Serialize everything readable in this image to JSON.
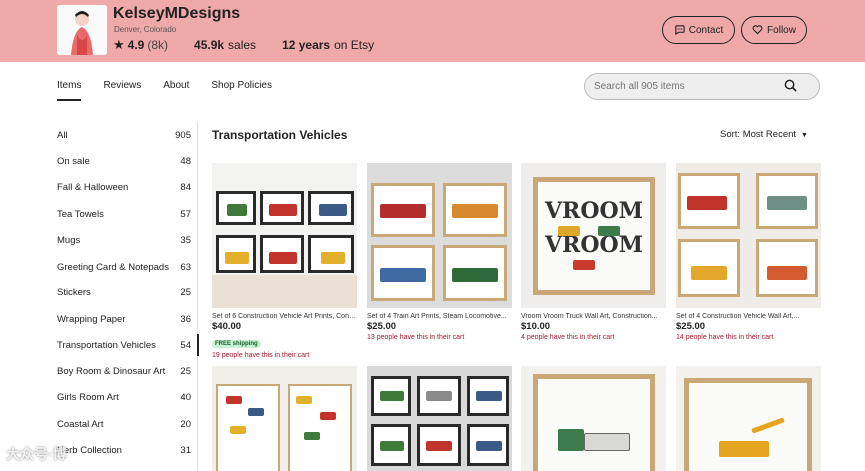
{
  "shop": {
    "name": "KelseyMDesigns",
    "location": "Denver, Colorado",
    "rating": "4.9",
    "rating_count": "(8k)",
    "sales_num": "45.9k",
    "sales_label": "sales",
    "years_num": "12 years",
    "years_label": "on Etsy",
    "contact_label": "Contact",
    "follow_label": "Follow",
    "header_color": "#f0a9a9"
  },
  "tabs": [
    {
      "label": "Items",
      "active": true
    },
    {
      "label": "Reviews"
    },
    {
      "label": "About"
    },
    {
      "label": "Shop Policies"
    }
  ],
  "search": {
    "placeholder": "Search all 905 items"
  },
  "sidebar": {
    "items": [
      {
        "label": "All",
        "count": "905"
      },
      {
        "label": "On sale",
        "count": "48"
      },
      {
        "label": "Fall & Halloween",
        "count": "84"
      },
      {
        "label": "Tea Towels",
        "count": "57"
      },
      {
        "label": "Mugs",
        "count": "35"
      },
      {
        "label": "Greeting Card & Notepads",
        "count": "63"
      },
      {
        "label": "Stickers",
        "count": "25"
      },
      {
        "label": "Wrapping Paper",
        "count": "36"
      },
      {
        "label": "Transportation Vehicles",
        "count": "54",
        "active": true
      },
      {
        "label": "Boy Room & Dinosaur Art",
        "count": "25"
      },
      {
        "label": "Girls Room Art",
        "count": "40"
      },
      {
        "label": "Coastal Art",
        "count": "20"
      },
      {
        "label": "Herb Collection",
        "count": "31"
      }
    ]
  },
  "main": {
    "section_title": "Transportation Vehicles",
    "sort_label": "Sort: Most Recent"
  },
  "listings": [
    {
      "title": "Set of 6 Construction Vehicle Art Prints, Construction...",
      "price": "$40.00",
      "badge": "FREE shipping",
      "cart": "19 people have this in their cart"
    },
    {
      "title": "Set of 4 Train Art Prints, Steam Locomotive...",
      "price": "$25.00",
      "cart": "13 people have this in their cart"
    },
    {
      "title": "Vroom Vroom Truck Wall Art, Construction...",
      "price": "$10.00",
      "cart": "4 people have this in their cart"
    },
    {
      "title": "Set of 4 Construction Vehicle Wall Art,...",
      "price": "$25.00",
      "cart": "14 people have this in their cart"
    }
  ],
  "artwork_text": {
    "vroom_top": "VROOM",
    "vroom_bottom": "VROOM"
  },
  "watermark": "大众号·博"
}
